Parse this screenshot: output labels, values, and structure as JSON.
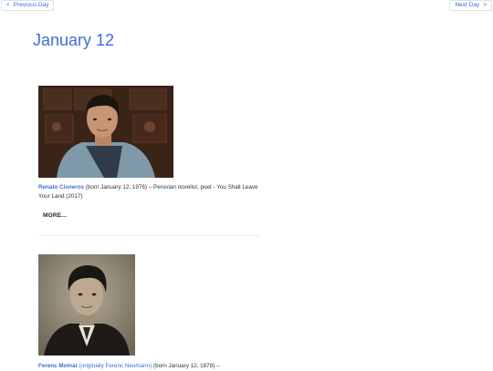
{
  "nav": {
    "prev_arrow": "<",
    "prev_label": "Previous Day",
    "next_label": "Next Day",
    "next_arrow": ">"
  },
  "page": {
    "title": "January 12"
  },
  "entries": [
    {
      "name": "Renato Cisneros",
      "details": " (born January 12, 1976) – Peruvian novelist, poet - You Shall Leave Your Land (2017)",
      "more_label": "MORE..."
    },
    {
      "name": "Ferenc Molnár",
      "alt_name": " (originally Ferenc Neumann)",
      "details": " (born January 12, 1878) –"
    }
  ],
  "colors": {
    "accent": "#3b6fd8",
    "text": "#333333",
    "divider": "#eceff3"
  }
}
